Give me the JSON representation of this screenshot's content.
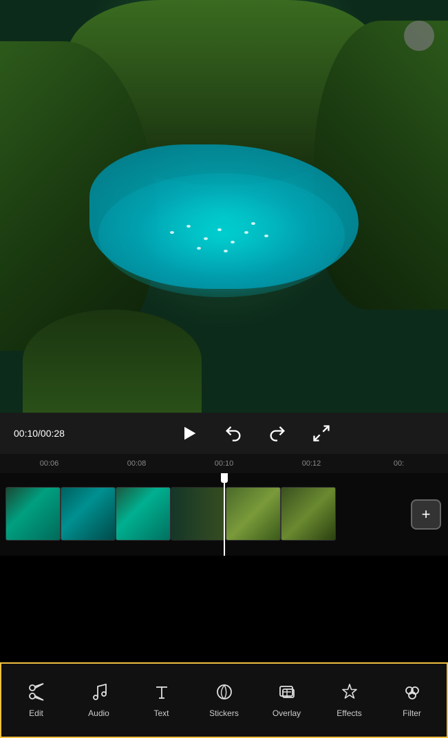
{
  "video": {
    "current_time": "00:10",
    "total_time": "00:28",
    "time_display": "00:10/00:28"
  },
  "timeline": {
    "marks": [
      "00:06",
      "00:08",
      "00:10",
      "00:12",
      "00:"
    ]
  },
  "controls": {
    "play_label": "▷",
    "undo_label": "↺",
    "redo_label": "↻",
    "expand_label": "⛶"
  },
  "toolbar": {
    "items": [
      {
        "id": "edit",
        "label": "Edit",
        "icon": "scissors"
      },
      {
        "id": "audio",
        "label": "Audio",
        "icon": "music"
      },
      {
        "id": "text",
        "label": "Text",
        "icon": "text"
      },
      {
        "id": "stickers",
        "label": "Stickers",
        "icon": "stickers"
      },
      {
        "id": "overlay",
        "label": "Overlay",
        "icon": "overlay"
      },
      {
        "id": "effects",
        "label": "Effects",
        "icon": "effects"
      },
      {
        "id": "filter",
        "label": "Filter",
        "icon": "filter"
      }
    ]
  },
  "add_button_label": "+",
  "colors": {
    "toolbar_border": "#f0c040",
    "background": "#000000",
    "playhead": "#ffffff",
    "accent": "#ffffff"
  }
}
